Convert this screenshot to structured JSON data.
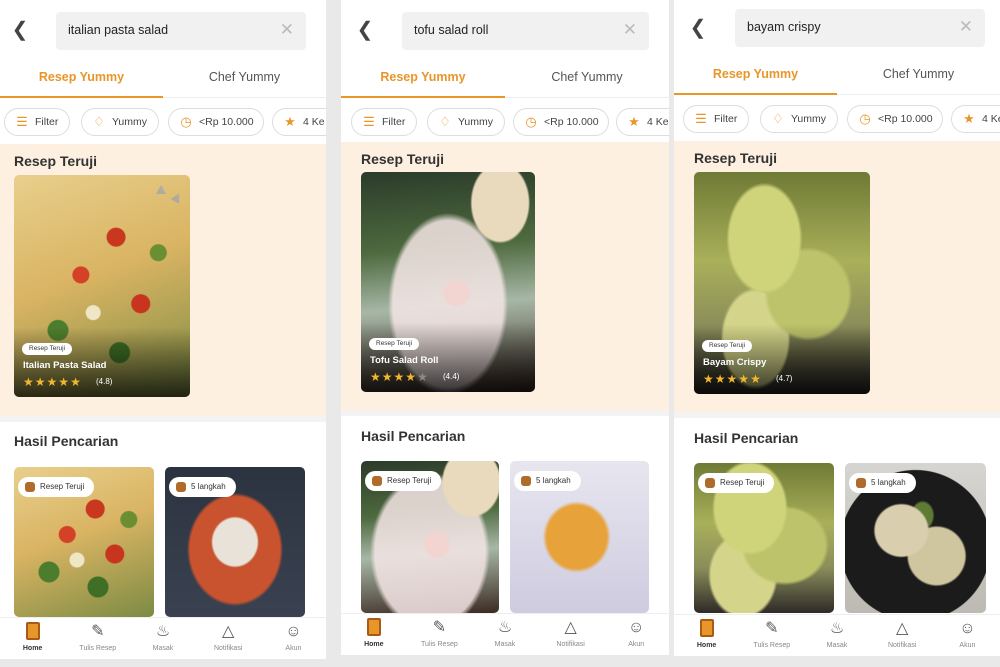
{
  "screens": [
    {
      "search_query": "italian pasta salad",
      "tabs": [
        "Resep Yummy",
        "Chef Yummy"
      ],
      "chips": [
        "Filter",
        "Yummy",
        "<Rp 10.000",
        "4 Ke"
      ],
      "featured_title": "Resep Teruji",
      "featured": {
        "badge": "Resep Teruji",
        "name": "Italian Pasta Salad",
        "rating": "(4.8)",
        "stars": 4.8,
        "image_icon": "pasta-salad-photo"
      },
      "results_title": "Hasil Pencarian",
      "results": [
        {
          "pill": "Resep Teruji",
          "image_icon": "pasta-salad-photo"
        },
        {
          "pill": "5 langkah",
          "image_icon": "baked-pasta-photo"
        }
      ]
    },
    {
      "search_query": "tofu salad roll",
      "tabs": [
        "Resep Yummy",
        "Chef Yummy"
      ],
      "chips": [
        "Filter",
        "Yummy",
        "<Rp 10.000",
        "4 Ke"
      ],
      "featured_title": "Resep Teruji",
      "featured": {
        "badge": "Resep Teruji",
        "name": "Tofu Salad Roll",
        "rating": "(4.4)",
        "stars": 4.4,
        "image_icon": "tofu-salad-roll-photo"
      },
      "results_title": "Hasil Pencarian",
      "results": [
        {
          "pill": "Resep Teruji",
          "image_icon": "tofu-salad-roll-photo"
        },
        {
          "pill": "5 langkah",
          "image_icon": "fried-roll-photo"
        }
      ]
    },
    {
      "search_query": "bayam crispy",
      "tabs": [
        "Resep Yummy",
        "Chef Yummy"
      ],
      "chips": [
        "Filter",
        "Yummy",
        "<Rp 10.000",
        "4 Ke"
      ],
      "featured_title": "Resep Teruji",
      "featured": {
        "badge": "Resep Teruji",
        "name": "Bayam Crispy",
        "rating": "(4.7)",
        "stars": 4.7,
        "image_icon": "bayam-crispy-photo"
      },
      "results_title": "Hasil Pencarian",
      "results": [
        {
          "pill": "Resep Teruji",
          "image_icon": "bayam-crispy-photo"
        },
        {
          "pill": "5 langkah",
          "image_icon": "tempura-photo"
        }
      ]
    }
  ],
  "nav": [
    "Home",
    "Tulis Resep",
    "Masak",
    "Notifikasi",
    "Akun"
  ],
  "nav_icons": [
    "home-icon",
    "write-recipe-icon",
    "cook-icon",
    "notification-bell-icon",
    "account-icon"
  ],
  "colors": {
    "accent": "#e8962a",
    "featured_band": "#fdf0e1",
    "star": "#f1b82d"
  }
}
